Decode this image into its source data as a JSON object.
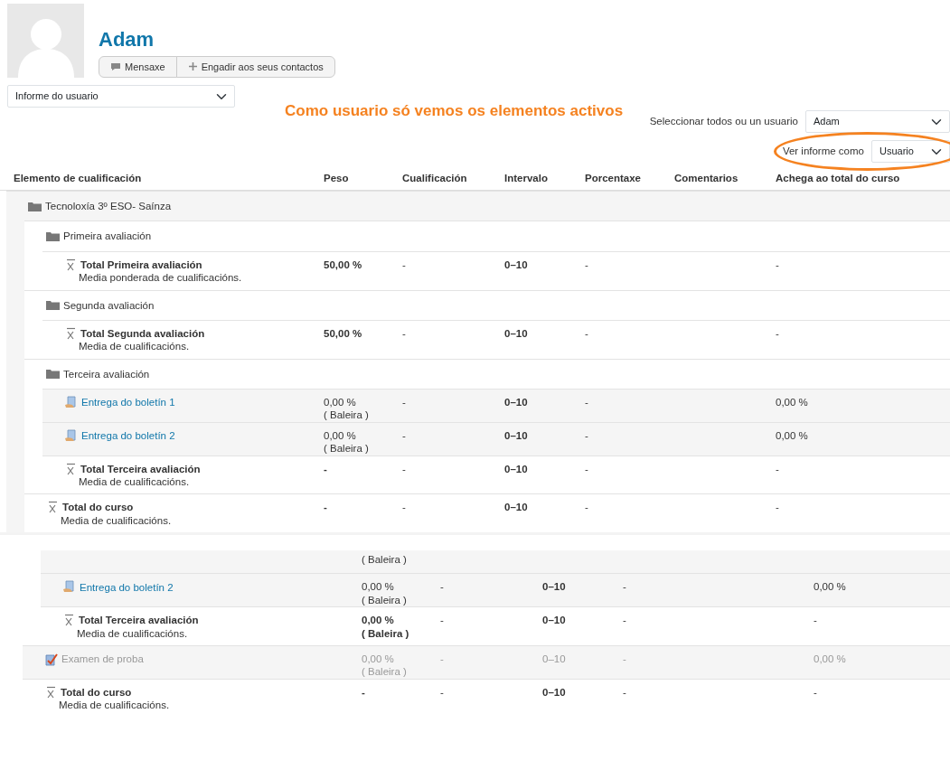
{
  "profile": {
    "name": "Adam",
    "buttons": [
      {
        "label": "Mensaxe"
      },
      {
        "label": "Engadir aos seus contactos"
      }
    ]
  },
  "report_select": {
    "value": "Informe do usuario"
  },
  "annotation": "Como usuario só vemos os elementos activos",
  "user_select": {
    "label": "Seleccionar todos ou un usuario",
    "value": "Adam"
  },
  "view_as": {
    "label": "Ver informe como",
    "value": "Usuario",
    "highlighted": true
  },
  "columns": [
    "Elemento de cualificación",
    "Peso",
    "Cualificación",
    "Intervalo",
    "Porcentaxe",
    "Comentarios",
    "Achega ao total do curso"
  ],
  "rows": [
    {
      "kind": "category",
      "name": "Tecnoloxía 3º ESO- Saínza",
      "children": [
        {
          "kind": "category",
          "name": "Primeira avaliación",
          "children": [
            {
              "kind": "total",
              "name": "Total Primeira avaliación",
              "description": "Media ponderada de cualificacións.",
              "weight": "50,00 %",
              "grade": "-",
              "range": "0–10",
              "percentage": "-",
              "contribution": "-"
            }
          ]
        },
        {
          "kind": "category",
          "name": "Segunda avaliación",
          "children": [
            {
              "kind": "total",
              "name": "Total Segunda avaliación",
              "description": "Media de cualificacións.",
              "weight": "50,00 %",
              "grade": "-",
              "range": "0–10",
              "percentage": "-",
              "contribution": "-"
            }
          ]
        },
        {
          "kind": "category",
          "name": "Terceira avaliación",
          "children": [
            {
              "kind": "assignment",
              "hidden": false,
              "name": "Entrega do boletín 1",
              "weight": "0,00 %",
              "weight_note": "( Baleira )",
              "grade": "-",
              "range": "0–10",
              "percentage": "-",
              "contribution": "0,00 %"
            },
            {
              "kind": "assignment",
              "hidden": false,
              "name": "Entrega do boletín 2",
              "weight": "0,00 %",
              "weight_note": "( Baleira )",
              "grade": "-",
              "range": "0–10",
              "percentage": "-",
              "contribution": "0,00 %"
            },
            {
              "kind": "total",
              "name": "Total Terceira avaliación",
              "description": "Media de cualificacións.",
              "weight": "-",
              "grade": "-",
              "range": "0–10",
              "percentage": "-",
              "contribution": "-"
            }
          ]
        },
        {
          "kind": "total",
          "name": "Total do curso",
          "description": "Media de cualificacións.",
          "weight": "-",
          "grade": "-",
          "range": "0–10",
          "percentage": "-",
          "contribution": "-"
        }
      ]
    }
  ],
  "second_view": {
    "rows": [
      {
        "kind": "group",
        "children": [
          {
            "kind": "clipped",
            "weight_note": "( Baleira )"
          },
          {
            "kind": "assignment",
            "hidden": false,
            "name": "Entrega do boletín 2",
            "weight": "0,00 %",
            "weight_note": "( Baleira )",
            "grade": "-",
            "range": "0–10",
            "percentage": "-",
            "contribution": "0,00 %"
          },
          {
            "kind": "total",
            "name": "Total Terceira avaliación",
            "description": "Media de cualificacións.",
            "weight": "0,00 %",
            "weight_note": "( Baleira )",
            "grade": "-",
            "range": "0–10",
            "percentage": "-",
            "contribution": "-"
          }
        ]
      },
      {
        "kind": "quiz",
        "hidden": true,
        "name": "Examen de proba",
        "weight": "0,00 %",
        "weight_note": "( Baleira )",
        "grade": "-",
        "range": "0–10",
        "percentage": "-",
        "contribution": "0,00 %"
      },
      {
        "kind": "total",
        "name": "Total do curso",
        "description": "Media de cualificacións.",
        "weight": "-",
        "grade": "-",
        "range": "0–10",
        "percentage": "-",
        "contribution": "-"
      }
    ]
  }
}
